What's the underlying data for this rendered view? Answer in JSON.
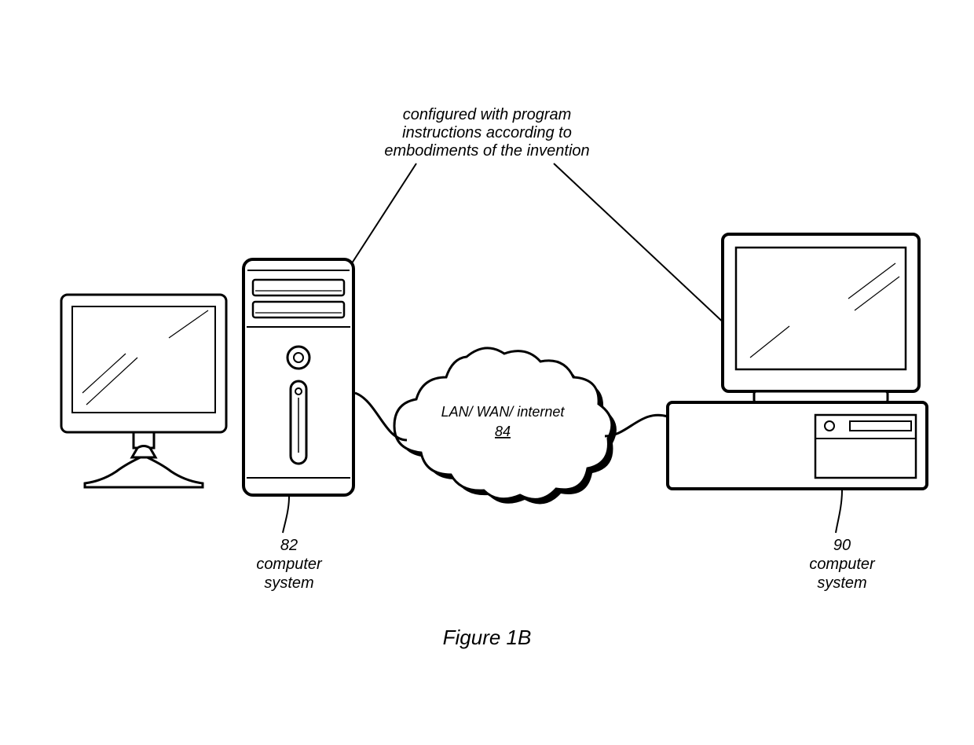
{
  "annotation": {
    "line1": "configured with program",
    "line2": "instructions according to",
    "line3": "embodiments of the invention"
  },
  "cloud": {
    "line1": "LAN/ WAN/ internet",
    "refnum": "84"
  },
  "left_system": {
    "refnum": "82",
    "label1": "computer",
    "label2": "system"
  },
  "right_system": {
    "refnum": "90",
    "label1": "computer",
    "label2": "system"
  },
  "figure_caption": "Figure 1B"
}
